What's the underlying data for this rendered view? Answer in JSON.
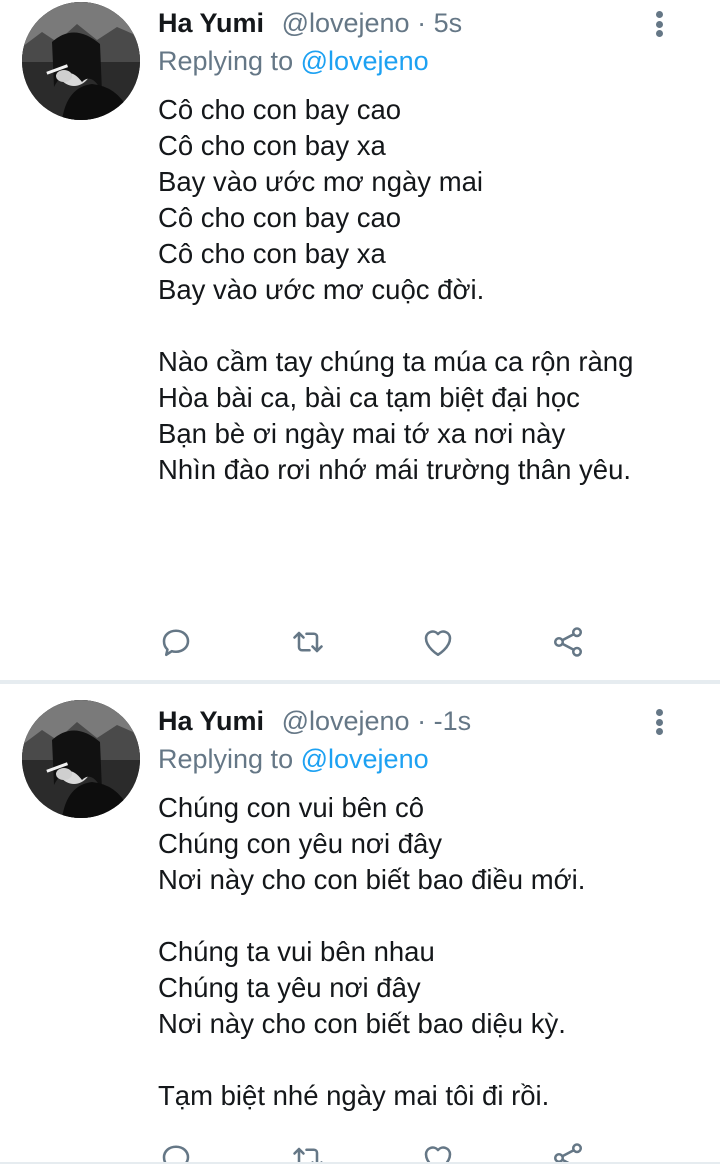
{
  "tweets": [
    {
      "author_name": "Ha Yumi",
      "handle": "@lovejeno",
      "separator": "·",
      "time": "5s",
      "replying_prefix": "Replying to",
      "replying_to": "@lovejeno",
      "lines": [
        "Cô cho con bay cao",
        "Cô cho con bay xa",
        "Bay vào ước mơ ngày mai",
        "Cô cho con bay cao",
        "Cô cho con bay xa",
        "Bay vào ước mơ cuộc đời.",
        "",
        "Nào cầm tay chúng ta múa ca rộn ràng",
        "Hòa bài ca, bài ca tạm biệt đại học",
        "Bạn bè ơi ngày mai tớ xa nơi này",
        "Nhìn đào rơi nhớ mái trường thân yêu."
      ]
    },
    {
      "author_name": "Ha Yumi",
      "handle": "@lovejeno",
      "separator": "·",
      "time": "-1s",
      "replying_prefix": "Replying to",
      "replying_to": "@lovejeno",
      "lines": [
        "Chúng con vui bên cô",
        "Chúng con yêu nơi đây",
        "Nơi này cho con biết bao điều mới.",
        "",
        "Chúng ta vui bên nhau",
        "Chúng ta yêu nơi đây",
        "Nơi này cho con biết bao diệu kỳ.",
        "",
        "Tạm biệt nhé ngày mai tôi đi rồi."
      ]
    }
  ],
  "icons": {
    "reply": "reply-icon",
    "retweet": "retweet-icon",
    "like": "like-icon",
    "share": "share-icon",
    "more": "more-vertical-icon"
  },
  "colors": {
    "text": "#14171a",
    "secondary": "#657786",
    "accent": "#1da1f2",
    "separator": "#e6ecf0"
  }
}
